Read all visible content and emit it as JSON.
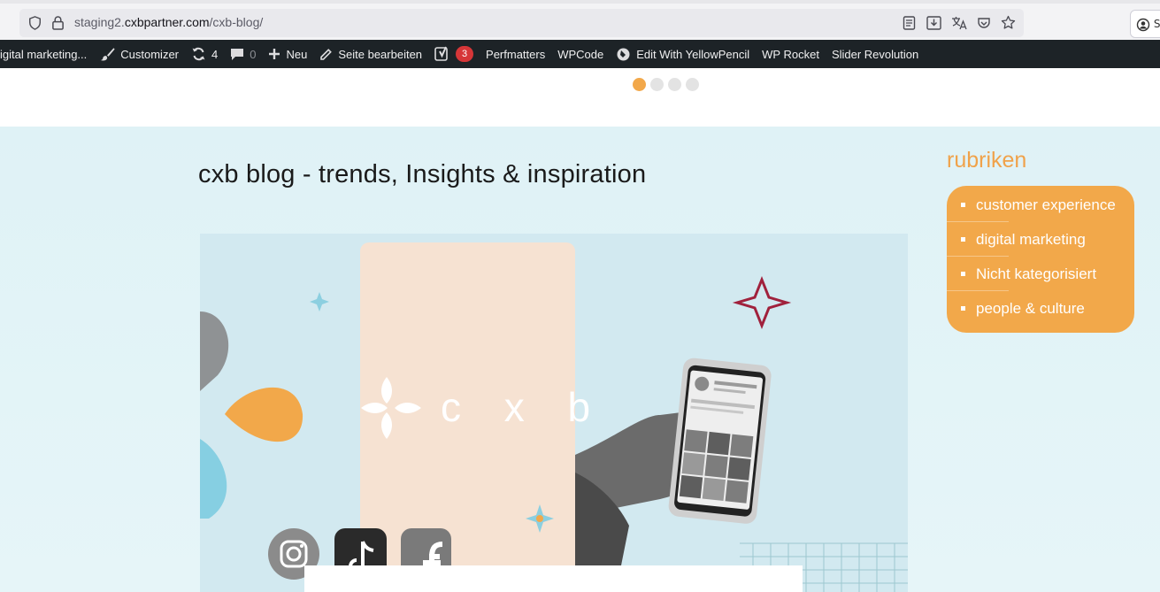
{
  "browser": {
    "url_prefix": "staging2.",
    "url_domain": "cxbpartner.com",
    "url_path": "/cxb-blog/",
    "account_label": "S",
    "icons": [
      "shield-icon",
      "lock-icon",
      "reader-view-icon",
      "download-icon",
      "translate-icon",
      "pocket-icon",
      "bookmark-star-icon",
      "account-icon"
    ]
  },
  "adminbar": {
    "site_name": "igital marketing...",
    "customizer": "Customizer",
    "updates_count": "4",
    "comments_count": "0",
    "new_label": "Neu",
    "edit_page": "Seite bearbeiten",
    "yoast_count": "3",
    "perfmatters": "Perfmatters",
    "wpcode": "WPCode",
    "yellowpencil": "Edit With YellowPencil",
    "wprocket": "WP Rocket",
    "slider_revolution": "Slider Revolution"
  },
  "slider": {
    "dots_total": 4,
    "active_index": 0
  },
  "main": {
    "title": "cxb blog - trends, Insights & inspiration",
    "hero_logo_text": "c x b"
  },
  "sidebar": {
    "title": "rubriken",
    "categories": [
      {
        "label": "customer experience"
      },
      {
        "label": "digital marketing"
      },
      {
        "label": "Nicht kategorisiert"
      },
      {
        "label": "people & culture"
      }
    ]
  },
  "colors": {
    "accent_orange": "#f2a84a",
    "admin_bar": "#1d2327",
    "badge_red": "#d63638",
    "content_bg": "#dff2f6"
  }
}
